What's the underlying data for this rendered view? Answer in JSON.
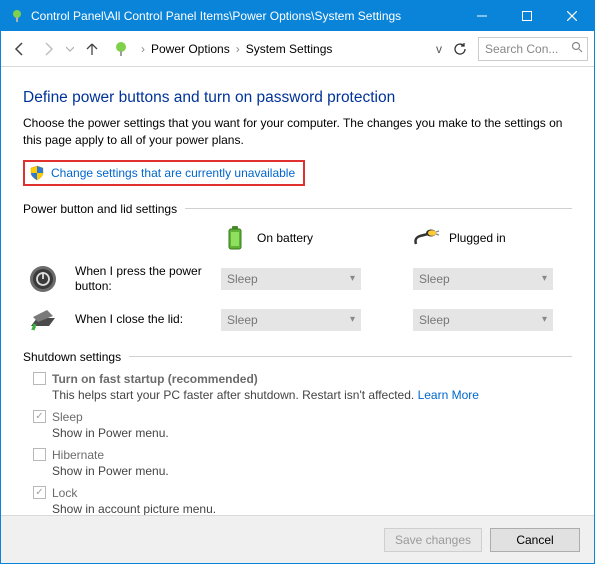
{
  "window": {
    "title": "Control Panel\\All Control Panel Items\\Power Options\\System Settings"
  },
  "nav": {
    "crumb1": "Power Options",
    "crumb2": "System Settings",
    "search_placeholder": "Search Con..."
  },
  "page": {
    "heading": "Define power buttons and turn on password protection",
    "intro": "Choose the power settings that you want for your computer. The changes you make to the settings on this page apply to all of your power plans.",
    "change_link": "Change settings that are currently unavailable"
  },
  "power_section": {
    "header": "Power button and lid settings",
    "col_battery": "On battery",
    "col_plugged": "Plugged in",
    "row1_label": "When I press the power button:",
    "row2_label": "When I close the lid:",
    "row1_battery": "Sleep",
    "row1_plugged": "Sleep",
    "row2_battery": "Sleep",
    "row2_plugged": "Sleep"
  },
  "shutdown_section": {
    "header": "Shutdown settings",
    "items": [
      {
        "checked": false,
        "title": "Turn on fast startup (recommended)",
        "bold": true,
        "desc": "This helps start your PC faster after shutdown. Restart isn't affected. ",
        "link": "Learn More"
      },
      {
        "checked": true,
        "title": "Sleep",
        "bold": false,
        "desc": "Show in Power menu.",
        "link": ""
      },
      {
        "checked": false,
        "title": "Hibernate",
        "bold": false,
        "desc": "Show in Power menu.",
        "link": ""
      },
      {
        "checked": true,
        "title": "Lock",
        "bold": false,
        "desc": "Show in account picture menu.",
        "link": ""
      }
    ]
  },
  "footer": {
    "save": "Save changes",
    "cancel": "Cancel"
  }
}
